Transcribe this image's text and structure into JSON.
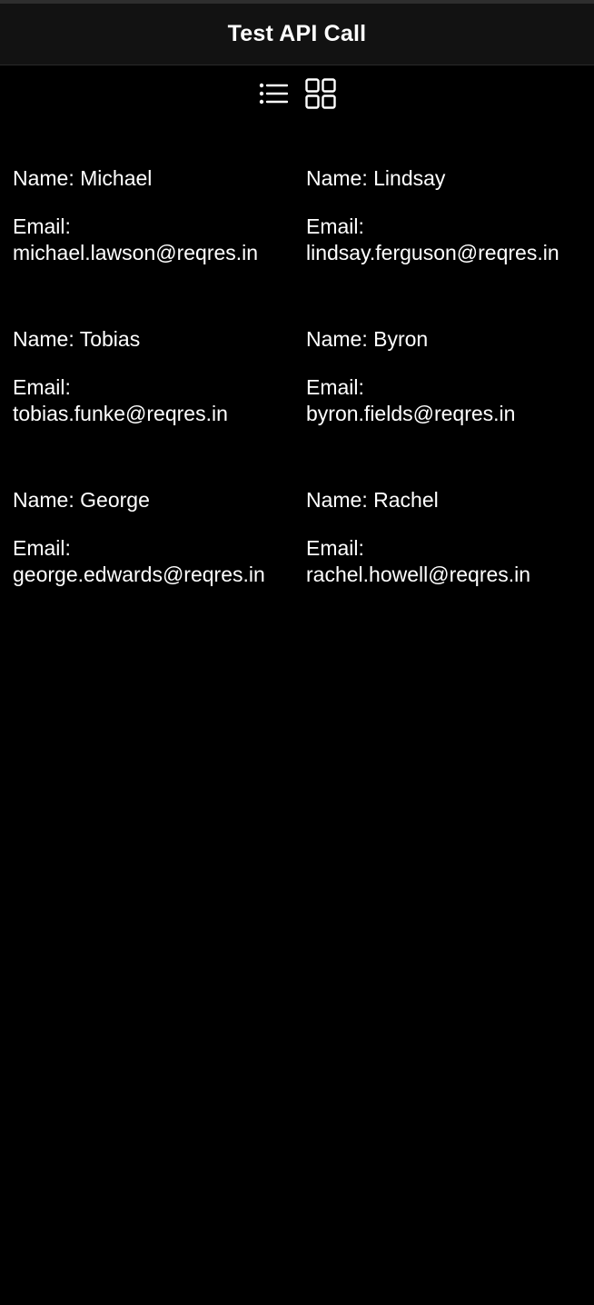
{
  "header": {
    "title": "Test API Call"
  },
  "view_toggle": {
    "options": [
      {
        "icon": "list-icon",
        "selected": false
      },
      {
        "icon": "grid-icon",
        "selected": true
      }
    ]
  },
  "users": [
    {
      "name_prefix": "Name: ",
      "name": "Michael",
      "email_label": "Email:",
      "email": "michael.lawson@reqres.in"
    },
    {
      "name_prefix": "Name: ",
      "name": "Lindsay",
      "email_label": "Email:",
      "email": "lindsay.ferguson@reqres.in"
    },
    {
      "name_prefix": "Name: ",
      "name": "Tobias",
      "email_label": "Email:",
      "email": "tobias.funke@reqres.in"
    },
    {
      "name_prefix": "Name: ",
      "name": "Byron",
      "email_label": "Email:",
      "email": "byron.fields@reqres.in"
    },
    {
      "name_prefix": "Name: ",
      "name": "George",
      "email_label": "Email:",
      "email": "george.edwards@reqres.in"
    },
    {
      "name_prefix": "Name: ",
      "name": "Rachel",
      "email_label": "Email:",
      "email": "rachel.howell@reqres.in"
    }
  ],
  "colors": {
    "background": "#000000",
    "navbar": "#121212",
    "text": "#ffffff"
  }
}
